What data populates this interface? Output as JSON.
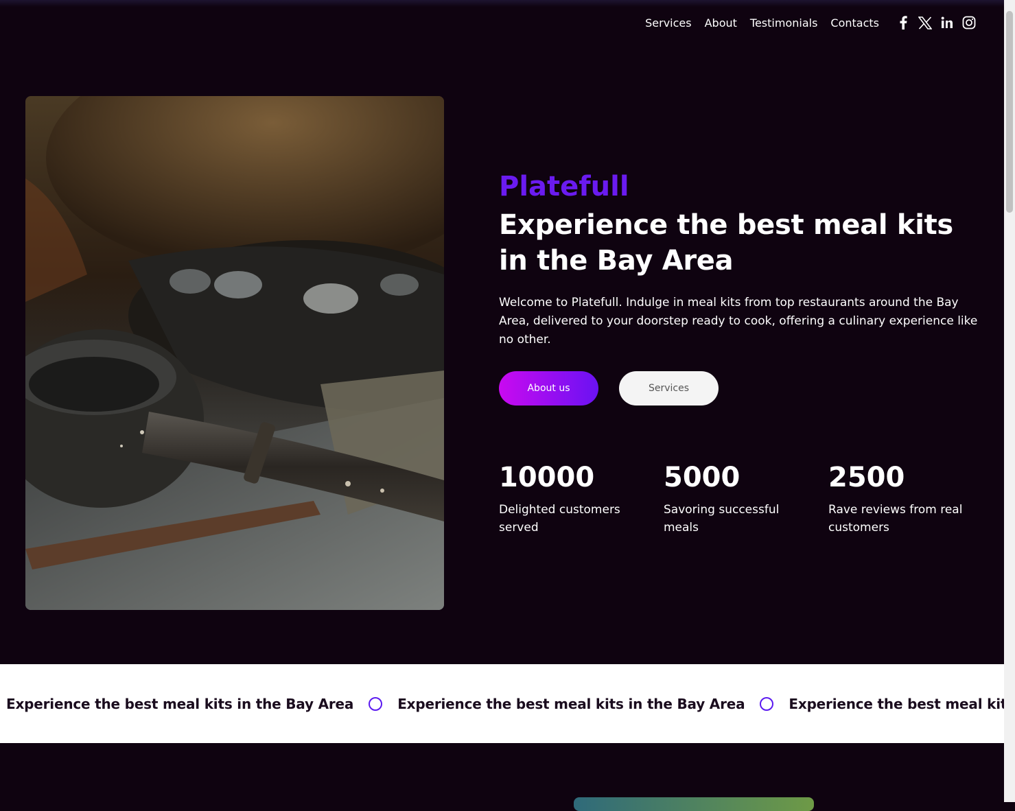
{
  "nav": {
    "links": [
      "Services",
      "About",
      "Testimonials",
      "Contacts"
    ],
    "social_icons": [
      "facebook-icon",
      "x-twitter-icon",
      "linkedin-icon",
      "instagram-icon"
    ]
  },
  "hero": {
    "image_icon": "cookware-photo",
    "brand": "Platefull",
    "headline": "Experience the best meal kits in the Bay Area",
    "intro": "Welcome to Platefull. Indulge in meal kits from top restaurants around the Bay Area, delivered to your doorstep ready to cook, offering a culinary experience like no other.",
    "primary_button": "About us",
    "secondary_button": "Services"
  },
  "stats": [
    {
      "value": "10000",
      "label": "Delighted customers served"
    },
    {
      "value": "5000",
      "label": "Savoring successful meals"
    },
    {
      "value": "2500",
      "label": "Rave reviews from real customers"
    }
  ],
  "marquee": {
    "items": [
      "Experience the best meal kits in the Bay Area",
      "Experience the best meal kits in the Bay Area",
      "Experience the best meal kits in the Bay Area"
    ],
    "separator_icon": "circle-outline-icon"
  },
  "colors": {
    "background": "#0f0310",
    "brand_accent": "#6a1bf0",
    "button_gradient_start": "#c90af0",
    "button_gradient_end": "#6a12f2"
  }
}
